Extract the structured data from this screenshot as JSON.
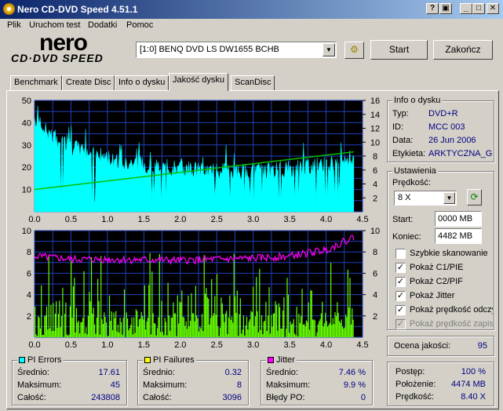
{
  "window": {
    "title": "Nero CD-DVD Speed 4.51.1",
    "btn_help": "?",
    "btn_min": "_",
    "btn_max": "□",
    "btn_close": "✕"
  },
  "menu": [
    "Plik",
    "Uruchom test",
    "Dodatki",
    "Pomoc"
  ],
  "logo": {
    "top": "nero",
    "bottom": "CD·DVD SPEED"
  },
  "drive": {
    "selected": "[1:0]  BENQ DVD LS DW1655 BCHB",
    "start_label": "Start",
    "exit_label": "Zakończ"
  },
  "tabs": [
    "Benchmark",
    "Create Disc",
    "Info o dysku",
    "Jakość dysku",
    "ScanDisc"
  ],
  "active_tab": 3,
  "disc_info": {
    "title": "Info o dysku",
    "type_label": "Typ:",
    "type": "DVD+R",
    "id_label": "ID:",
    "id": "MCC 003",
    "date_label": "Data:",
    "date": "26 Jun 2006",
    "label_label": "Etykieta:",
    "label": "ARKTYCZNA_GI"
  },
  "settings": {
    "title": "Ustawienia",
    "speed_label": "Prędkość:",
    "speed": "8 X",
    "start_label": "Start:",
    "start": "0000 MB",
    "end_label": "Koniec:",
    "end": "4482 MB",
    "checks": [
      {
        "label": "Szybkie skanowanie",
        "checked": false,
        "disabled": false
      },
      {
        "label": "Pokaż C1/PIE",
        "checked": true,
        "disabled": false
      },
      {
        "label": "Pokaż C2/PIF",
        "checked": true,
        "disabled": false
      },
      {
        "label": "Pokaż Jitter",
        "checked": true,
        "disabled": false
      },
      {
        "label": "Pokaż prędkość odczytu",
        "checked": true,
        "disabled": false
      },
      {
        "label": "Pokaż prędkość zapisu",
        "checked": true,
        "disabled": true
      }
    ]
  },
  "quality": {
    "label": "Ocena jakości:",
    "value": "95"
  },
  "progress": {
    "progress_label": "Postęp:",
    "progress": "100 %",
    "position_label": "Położenie:",
    "position": "4474 MB",
    "speed_label": "Prędkość:",
    "speed": "8.40 X"
  },
  "pi_errors": {
    "title": "PI Errors",
    "avg_label": "Średnio:",
    "avg": "17.61",
    "max_label": "Maksimum:",
    "max": "45",
    "total_label": "Całość:",
    "total": "243808",
    "color": "#00ffff"
  },
  "pi_failures": {
    "title": "PI Failures",
    "avg_label": "Średnio:",
    "avg": "0.32",
    "max_label": "Maksimum:",
    "max": "8",
    "total_label": "Całość:",
    "total": "3096",
    "color": "#ffff00"
  },
  "jitter": {
    "title": "Jitter",
    "avg_label": "Średnio:",
    "avg": "7.46 %",
    "max_label": "Maksimum:",
    "max": "9.9 %",
    "po_label": "Błędy PO:",
    "po": "0",
    "color": "#ff00ff"
  },
  "chart_data": [
    {
      "type": "area",
      "series": [
        {
          "name": "PI Errors",
          "color": "#00ffff"
        },
        {
          "name": "Read speed",
          "color": "#00ff00"
        }
      ],
      "x_ticks": [
        "0.0",
        "0.5",
        "1.0",
        "1.5",
        "2.0",
        "2.5",
        "3.0",
        "3.5",
        "4.0",
        "4.5"
      ],
      "y_left_ticks": [
        "50",
        "40",
        "30",
        "20",
        "10"
      ],
      "y_right_ticks": [
        "16",
        "14",
        "12",
        "10",
        "8",
        "6",
        "4",
        "2"
      ],
      "xlim": [
        0,
        4.5
      ],
      "ylim_left": [
        0,
        50
      ],
      "ylim_right": [
        0,
        16
      ],
      "pie_profile": [
        [
          0,
          42
        ],
        [
          0.1,
          38
        ],
        [
          0.3,
          32
        ],
        [
          0.6,
          28
        ],
        [
          1.0,
          24
        ],
        [
          1.5,
          21
        ],
        [
          2.0,
          19
        ],
        [
          2.5,
          18
        ],
        [
          3.0,
          18
        ],
        [
          3.5,
          19
        ],
        [
          4.0,
          21
        ],
        [
          4.38,
          24
        ]
      ],
      "speed_line": [
        [
          0,
          3.2
        ],
        [
          4.38,
          8.6
        ]
      ]
    },
    {
      "type": "bar",
      "series": [
        {
          "name": "PI Failures",
          "color": "#66ff00"
        },
        {
          "name": "Jitter",
          "color": "#ff00ff"
        }
      ],
      "x_ticks": [
        "0.0",
        "0.5",
        "1.0",
        "1.5",
        "2.0",
        "2.5",
        "3.0",
        "3.5",
        "4.0",
        "4.5"
      ],
      "y_left_ticks": [
        "10",
        "8",
        "6",
        "4",
        "2"
      ],
      "y_right_ticks": [
        "10",
        "8",
        "6",
        "4",
        "2"
      ],
      "xlim": [
        0,
        4.5
      ],
      "ylim_left": [
        0,
        10
      ],
      "ylim_right": [
        0,
        10
      ],
      "jitter_profile": [
        [
          0,
          7.6
        ],
        [
          0.5,
          7.3
        ],
        [
          1.0,
          7.3
        ],
        [
          2.0,
          7.2
        ],
        [
          3.0,
          7.4
        ],
        [
          3.5,
          7.6
        ],
        [
          4.0,
          8.2
        ],
        [
          4.38,
          9.4
        ]
      ]
    }
  ]
}
